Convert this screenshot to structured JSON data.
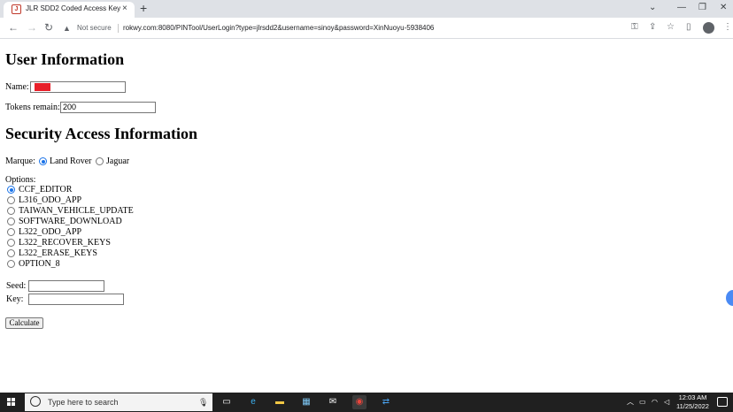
{
  "browser": {
    "tab_title": "JLR SDD2 Coded Access Key",
    "tab_favicon": "J",
    "tab_close": "×",
    "new_tab": "+",
    "security_label": "Not secure",
    "url": "rokwy.com:8080/PINTool/UserLogin?type=jlrsdd2&username=sinoy&password=XinNuoyu-5938406"
  },
  "page": {
    "user_heading": "User Information",
    "name_label": "Name:",
    "name_value": "",
    "tokens_label": "Tokens remain:",
    "tokens_value": "200",
    "security_heading": "Security Access Information",
    "marque_label": "Marque:",
    "marques": [
      {
        "label": "Land Rover",
        "checked": true
      },
      {
        "label": "Jaguar",
        "checked": false
      }
    ],
    "options_label": "Options:",
    "options": [
      {
        "label": "CCF_EDITOR",
        "checked": true
      },
      {
        "label": "L316_ODO_APP",
        "checked": false
      },
      {
        "label": "TAIWAN_VEHICLE_UPDATE",
        "checked": false
      },
      {
        "label": "SOFTWARE_DOWNLOAD",
        "checked": false
      },
      {
        "label": "L322_ODO_APP",
        "checked": false
      },
      {
        "label": "L322_RECOVER_KEYS",
        "checked": false
      },
      {
        "label": "L322_ERASE_KEYS",
        "checked": false
      },
      {
        "label": "OPTION_8",
        "checked": false
      }
    ],
    "seed_label": "Seed:",
    "seed_value": "",
    "key_label": "Key:",
    "key_value": "",
    "calculate_label": "Calculate",
    "redaction_color": "#e8202a",
    "radio_accent": "#1a73e8"
  },
  "taskbar": {
    "search_placeholder": "Type here to search",
    "time": "12:03 AM",
    "date": "11/25/2022"
  }
}
